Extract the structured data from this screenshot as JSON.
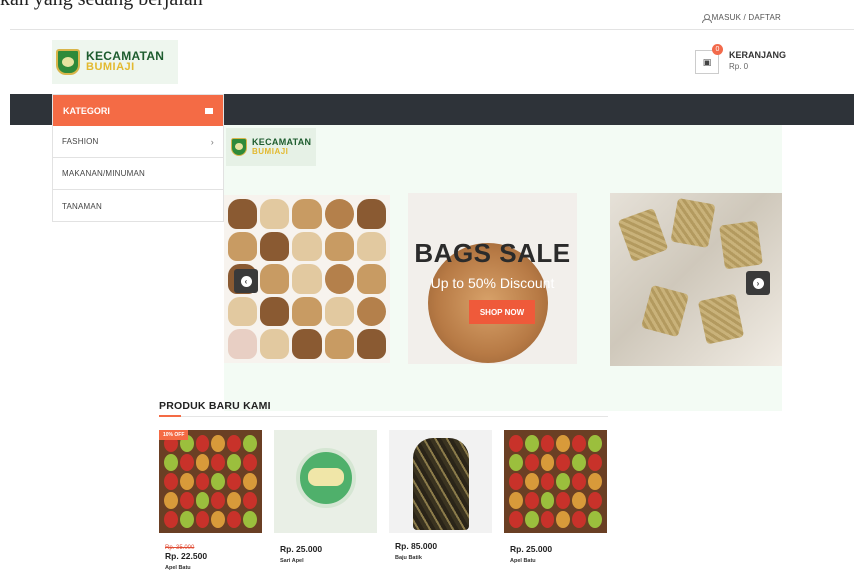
{
  "partial_text": "kan yang sedang berjalan",
  "topbar": {
    "login_label": "MASUK / DAFTAR"
  },
  "brand": {
    "line1": "KECAMATAN",
    "line2": "BUMIAJI"
  },
  "cart": {
    "count": "0",
    "label": "KERANJANG",
    "amount": "Rp. 0"
  },
  "category": {
    "header": "KATEGORI",
    "items": [
      {
        "label": "FASHION",
        "has_submenu": true
      },
      {
        "label": "MAKANAN/MINUMAN",
        "has_submenu": false
      },
      {
        "label": "TANAMAN",
        "has_submenu": false
      }
    ]
  },
  "hero": {
    "logo": {
      "line1": "KECAMATAN",
      "line2": "BUMIAJI"
    },
    "sale_title": "BAGS SALE",
    "sale_subtitle": "Up to 50% Discount",
    "shop_button": "SHOP NOW"
  },
  "products": {
    "section_title": "PRODUK BARU KAMI",
    "items": [
      {
        "badge": "10% OFF",
        "old_price": "Rp. 35.000",
        "price": "Rp. 22.500",
        "name": "Apel Batu",
        "image": "apples"
      },
      {
        "price": "Rp. 25.000",
        "name": "Sari Apel",
        "image": "apple-juice-cup"
      },
      {
        "price": "Rp. 85.000",
        "name": "Baju Batik",
        "image": "batik-shirt"
      },
      {
        "price": "Rp. 25.000",
        "name": "Apel Batu",
        "image": "apples"
      }
    ]
  },
  "colors": {
    "accent": "#f46b45",
    "navbar": "#2e3339"
  }
}
